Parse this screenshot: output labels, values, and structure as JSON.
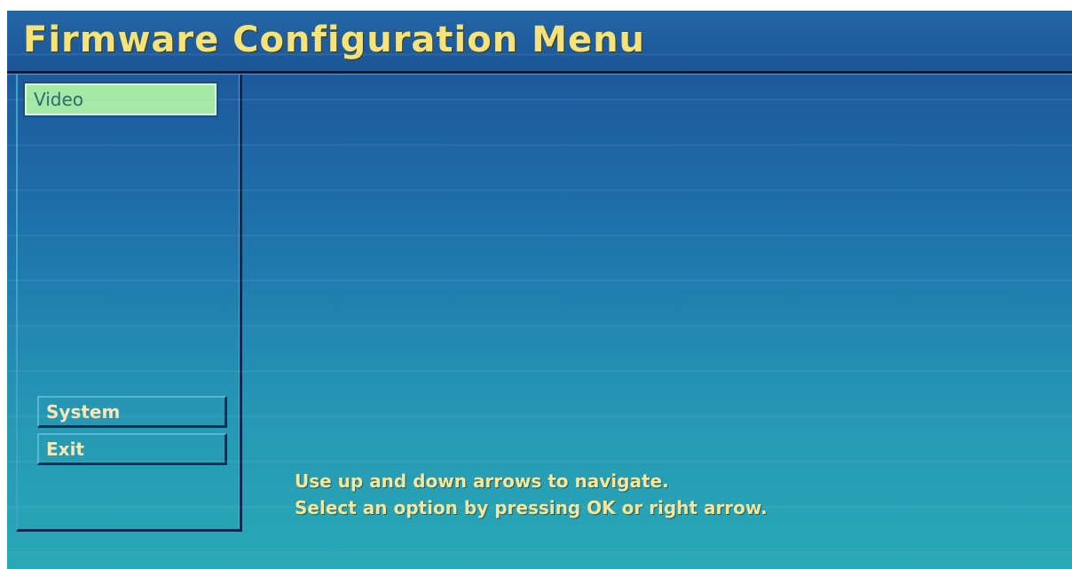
{
  "title": "Firmware Configuration Menu",
  "menu": {
    "items": [
      {
        "label": "Video",
        "selected": true
      },
      {
        "label": "System",
        "selected": false
      },
      {
        "label": "Exit",
        "selected": false
      }
    ]
  },
  "help": {
    "line1": "Use up and down arrows to navigate.",
    "line2": "Select an option by pressing OK or right arrow."
  },
  "colors": {
    "title_text": "#f5e27a",
    "background_top": "#1c4f98",
    "background_bottom": "#29a8b6",
    "selected_item": "#a6e8a6",
    "help_text": "#f5e89a"
  }
}
